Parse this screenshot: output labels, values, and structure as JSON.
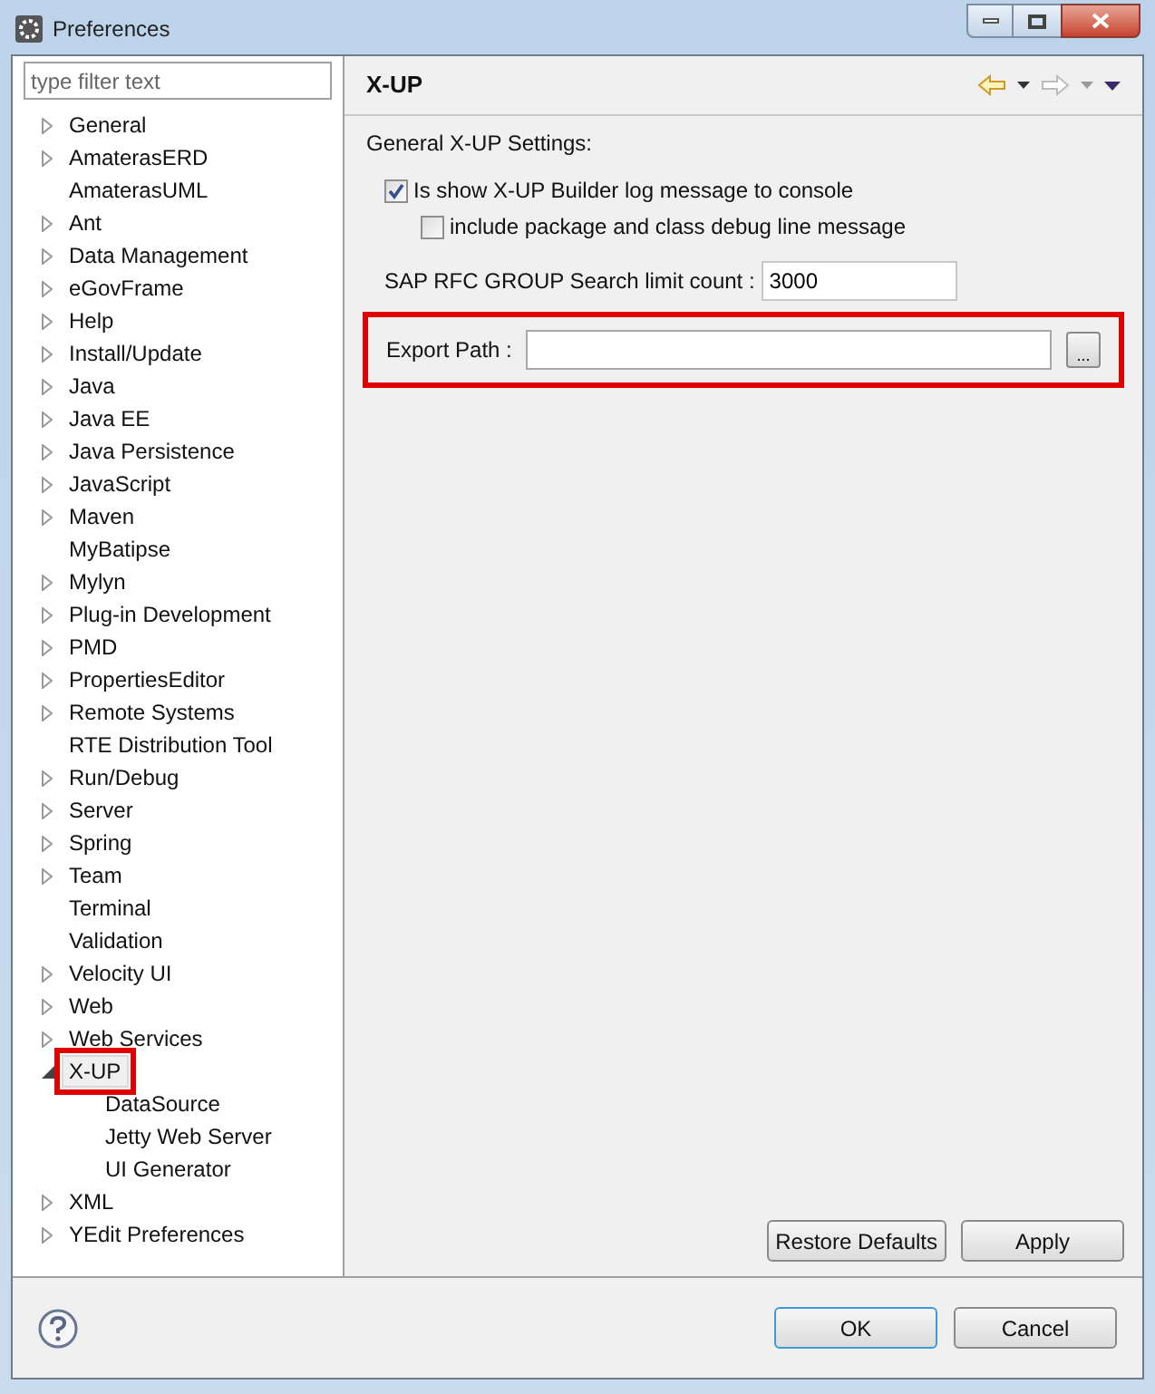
{
  "window": {
    "title": "Preferences"
  },
  "filter": {
    "placeholder": "type filter text"
  },
  "tree": [
    {
      "label": "General",
      "kind": "folder",
      "expanded": false,
      "selected": false,
      "highlighted": false
    },
    {
      "label": "AmaterasERD",
      "kind": "folder",
      "expanded": false,
      "selected": false,
      "highlighted": false
    },
    {
      "label": "AmaterasUML",
      "kind": "leaf",
      "selected": false,
      "highlighted": false
    },
    {
      "label": "Ant",
      "kind": "folder",
      "expanded": false,
      "selected": false,
      "highlighted": false
    },
    {
      "label": "Data Management",
      "kind": "folder",
      "expanded": false,
      "selected": false,
      "highlighted": false
    },
    {
      "label": "eGovFrame",
      "kind": "folder",
      "expanded": false,
      "selected": false,
      "highlighted": false
    },
    {
      "label": "Help",
      "kind": "folder",
      "expanded": false,
      "selected": false,
      "highlighted": false
    },
    {
      "label": "Install/Update",
      "kind": "folder",
      "expanded": false,
      "selected": false,
      "highlighted": false
    },
    {
      "label": "Java",
      "kind": "folder",
      "expanded": false,
      "selected": false,
      "highlighted": false
    },
    {
      "label": "Java EE",
      "kind": "folder",
      "expanded": false,
      "selected": false,
      "highlighted": false
    },
    {
      "label": "Java Persistence",
      "kind": "folder",
      "expanded": false,
      "selected": false,
      "highlighted": false
    },
    {
      "label": "JavaScript",
      "kind": "folder",
      "expanded": false,
      "selected": false,
      "highlighted": false
    },
    {
      "label": "Maven",
      "kind": "folder",
      "expanded": false,
      "selected": false,
      "highlighted": false
    },
    {
      "label": "MyBatipse",
      "kind": "leaf",
      "selected": false,
      "highlighted": false
    },
    {
      "label": "Mylyn",
      "kind": "folder",
      "expanded": false,
      "selected": false,
      "highlighted": false
    },
    {
      "label": "Plug-in Development",
      "kind": "folder",
      "expanded": false,
      "selected": false,
      "highlighted": false
    },
    {
      "label": "PMD",
      "kind": "folder",
      "expanded": false,
      "selected": false,
      "highlighted": false
    },
    {
      "label": "PropertiesEditor",
      "kind": "folder",
      "expanded": false,
      "selected": false,
      "highlighted": false
    },
    {
      "label": "Remote Systems",
      "kind": "folder",
      "expanded": false,
      "selected": false,
      "highlighted": false
    },
    {
      "label": "RTE Distribution Tool",
      "kind": "leaf",
      "selected": false,
      "highlighted": false
    },
    {
      "label": "Run/Debug",
      "kind": "folder",
      "expanded": false,
      "selected": false,
      "highlighted": false
    },
    {
      "label": "Server",
      "kind": "folder",
      "expanded": false,
      "selected": false,
      "highlighted": false
    },
    {
      "label": "Spring",
      "kind": "folder",
      "expanded": false,
      "selected": false,
      "highlighted": false
    },
    {
      "label": "Team",
      "kind": "folder",
      "expanded": false,
      "selected": false,
      "highlighted": false
    },
    {
      "label": "Terminal",
      "kind": "leaf",
      "selected": false,
      "highlighted": false
    },
    {
      "label": "Validation",
      "kind": "leaf",
      "selected": false,
      "highlighted": false
    },
    {
      "label": "Velocity UI",
      "kind": "folder",
      "expanded": false,
      "selected": false,
      "highlighted": false
    },
    {
      "label": "Web",
      "kind": "folder",
      "expanded": false,
      "selected": false,
      "highlighted": false
    },
    {
      "label": "Web Services",
      "kind": "folder",
      "expanded": false,
      "selected": false,
      "highlighted": false
    },
    {
      "label": "X-UP",
      "kind": "folder",
      "expanded": true,
      "selected": true,
      "highlighted": true,
      "children": [
        {
          "label": "DataSource",
          "selected": false,
          "highlighted": false
        },
        {
          "label": "Jetty Web Server",
          "selected": false,
          "highlighted": false
        },
        {
          "label": "UI Generator",
          "selected": false,
          "highlighted": false
        }
      ]
    },
    {
      "label": "XML",
      "kind": "folder",
      "expanded": false,
      "selected": false,
      "highlighted": false
    },
    {
      "label": "YEdit Preferences",
      "kind": "folder",
      "expanded": false,
      "selected": false,
      "highlighted": false
    }
  ],
  "page": {
    "title": "X-UP",
    "section": "General X-UP Settings:",
    "options": [
      {
        "label": "Is show X-UP Builder log message to console",
        "checked": true,
        "indented": false
      },
      {
        "label": "include package and class debug line message",
        "checked": false,
        "indented": true
      }
    ],
    "limit": {
      "label": "SAP RFC GROUP Search limit count :",
      "value": "3000"
    },
    "export": {
      "label": "Export Path :",
      "browse": "...",
      "highlighted": true
    },
    "buttons": [
      "Restore Defaults",
      "Apply"
    ]
  },
  "footer": {
    "buttons": [
      {
        "label": "OK",
        "default": true
      },
      {
        "label": "Cancel",
        "default": false
      }
    ]
  }
}
